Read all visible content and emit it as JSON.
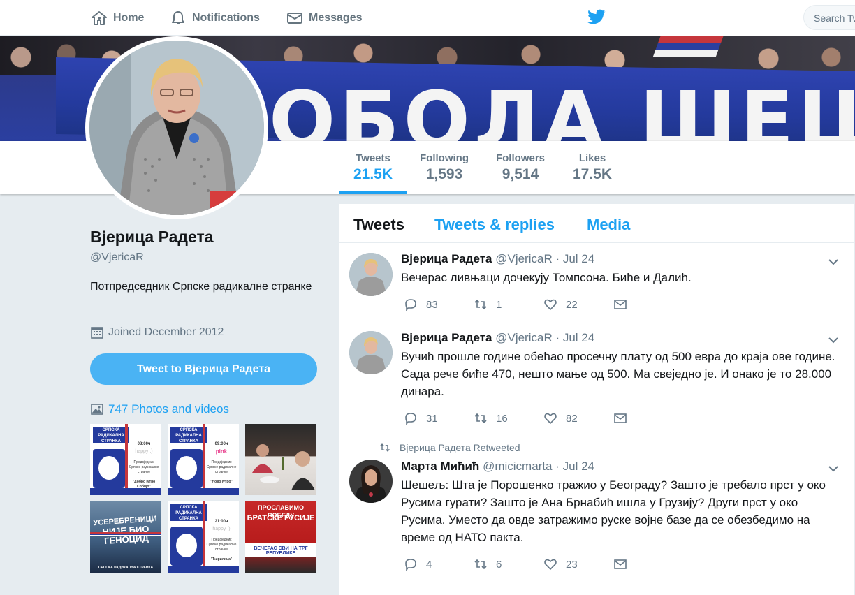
{
  "nav": {
    "home_label": "Home",
    "notifications_label": "Notifications",
    "messages_label": "Messages",
    "search_placeholder": "Search Tw"
  },
  "banner": {
    "text": "ОБОЛА ШЕШ"
  },
  "stats": [
    {
      "label": "Tweets",
      "value": "21.5K"
    },
    {
      "label": "Following",
      "value": "1,593"
    },
    {
      "label": "Followers",
      "value": "9,514"
    },
    {
      "label": "Likes",
      "value": "17.5K"
    }
  ],
  "profile": {
    "name": "Вјерица Радета",
    "handle": "@VjericaR",
    "bio": "Потпредседник Српске радикалне странке",
    "joined": "Joined December 2012",
    "tweet_to_label": "Tweet to Вјерица Радета",
    "photos_label": "747 Photos and videos"
  },
  "thumbs": [
    {
      "badge": "СРПСКА РАДИКАЛНА СТРАНКА",
      "time": "08:00ч",
      "logo": "happy :)",
      "text": "Предсједник Српске радикалне странке",
      "show": "\"Добро јутро Србијо\""
    },
    {
      "badge": "СРПСКА РАДИКАЛНА СТРАНКА",
      "time": "09:00ч",
      "logo": "pink",
      "text": "Предсједник Српске радикалне странке",
      "show": "\"Ново јутро\""
    },
    {
      "title": ""
    },
    {
      "line1": "УСЕРЕБРЕНИЦИ",
      "line2": "НИЈЕ БИО",
      "line3": "ГЕНОЦИД",
      "foot": "СРПСКА РАДИКАЛНА СТРАНКА"
    },
    {
      "badge": "СРПСКА РАДИКАЛНА СТРАНКА",
      "time": "21:00ч",
      "logo": "happy :)",
      "text": "Предсједник Српске радикалне странке",
      "show": "\"Ћирилица\""
    },
    {
      "line1": "ПРОСЛАВИМО ПОБЕДУ",
      "line2": "БРАТСКЕ РУСИЈЕ",
      "foot": "ВЕЧЕРАС СВИ НА ТРГ РЕПУБЛИКЕ"
    }
  ],
  "tabs": {
    "tweets": "Tweets",
    "replies": "Tweets & replies",
    "media": "Media"
  },
  "tweets": [
    {
      "name": "Вјерица Радета",
      "handle": "@VjericaR",
      "date": "· Jul 24",
      "text": "Вечерас ливњаци дочекују Томпсона. Биће и Далић.",
      "replies": "83",
      "retweets": "1",
      "likes": "22"
    },
    {
      "name": "Вјерица Радета",
      "handle": "@VjericaR",
      "date": "· Jul 24",
      "text": "Вучић прошле године обећао просечну плату од 500 евра до краја ове године. Сада рече биће 470, нешто мање од 500.  Ма свеједно је. И онако је то 28.000 динара.",
      "replies": "31",
      "retweets": "16",
      "likes": "82"
    },
    {
      "retweet_note": "Вјерица Радета Retweeted",
      "name": "Марта Мићић",
      "handle": "@micicmarta",
      "date": "· Jul 24",
      "text": "Шешељ: Шта је Порошенко тражио у Београду? Зашто је требало прст у око Русима гурати? Зашто је Ана Брнабић ишла у Грузију? Други прст у око Русима. Уместо да овде затражимо руске војне базе да се обезбедимо на време од НАТО пакта.",
      "replies": "4",
      "retweets": "6",
      "likes": "23"
    }
  ],
  "colors": {
    "accent": "#1da1f2",
    "button": "#4ab3f4",
    "muted": "#657786"
  }
}
